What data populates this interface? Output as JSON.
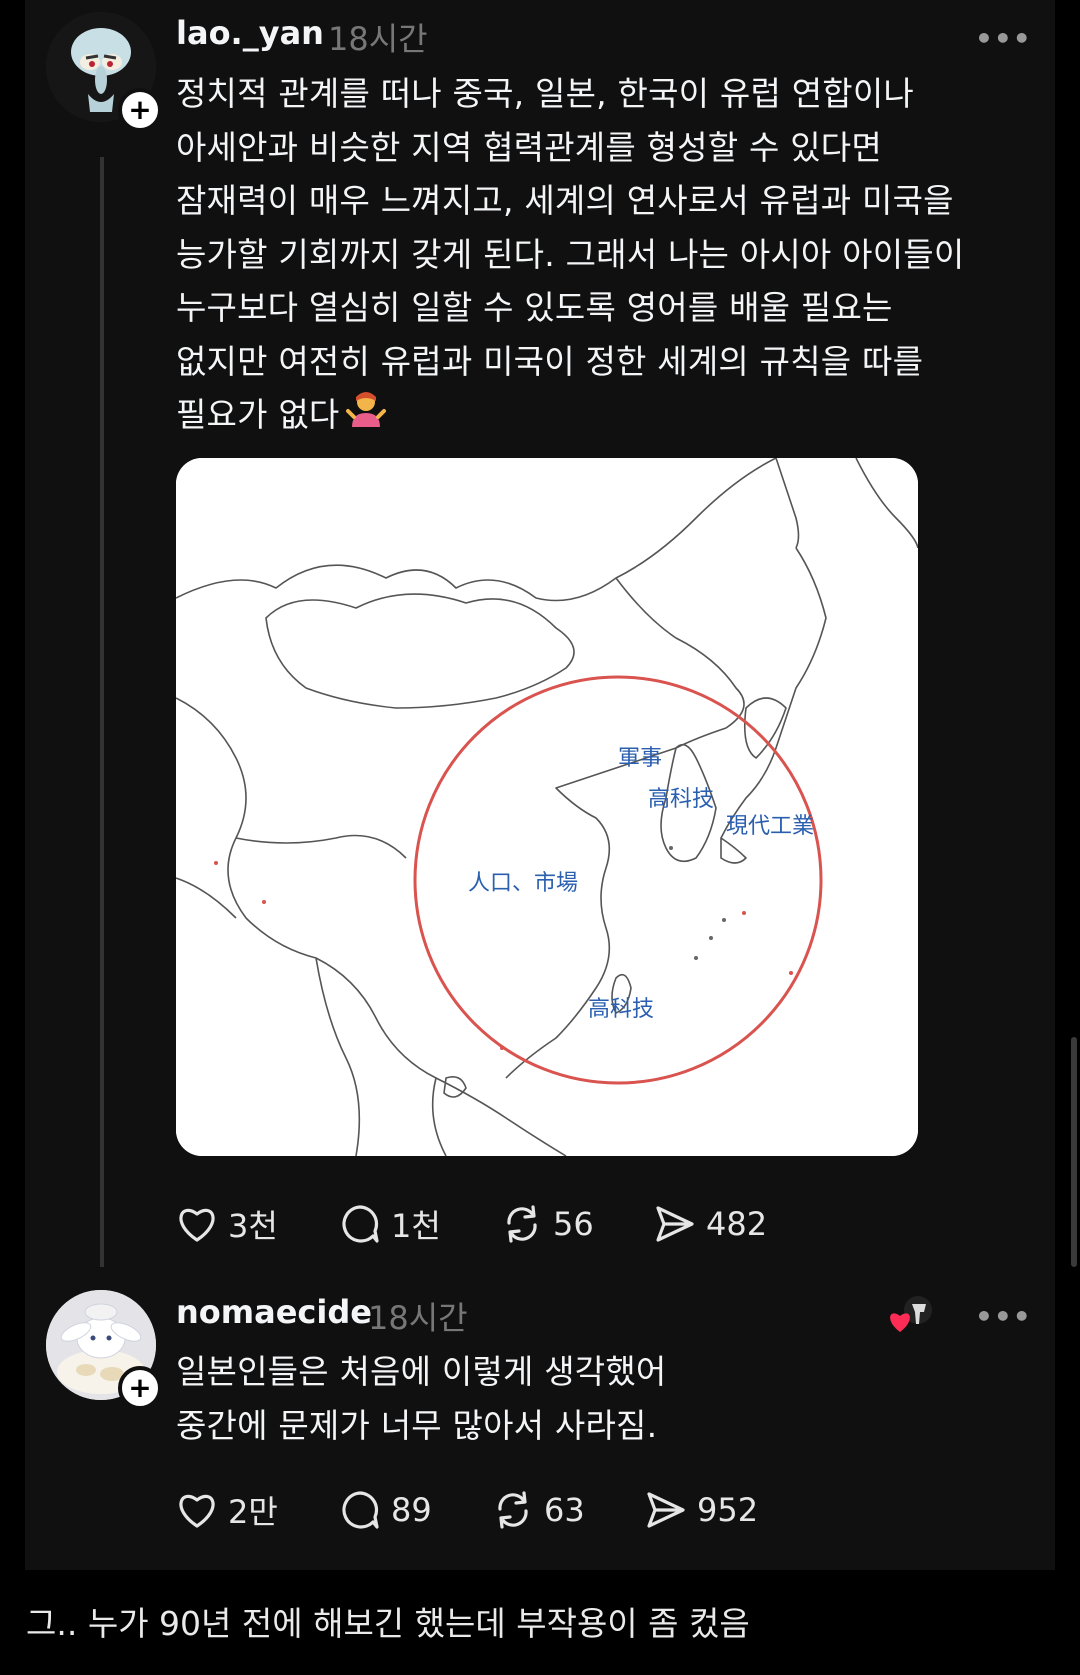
{
  "post": {
    "username": "lao._yan",
    "time": "18시간",
    "text": "정치적 관계를 떠나 중국, 일본, 한국이 유럽 연합이나\n아세안과 비슷한 지역 협력관계를 형성할 수 있다면\n잠재력이 매우 느껴지고, 세계의 연사로서 유럽과 미국을\n능가할 기회까지 갖게 된다. 그래서 나는 아시아 아이들이\n누구보다 열심히 일할 수 있도록 영어를 배울 필요는\n없지만 여전히 유럽과 미국이 정한 세계의 규칙을 따를\n필요가 없다",
    "map": {
      "labels": {
        "military": "軍事",
        "hightech_korea": "高科技",
        "modern_industry": "現代工業",
        "population_market": "人口、市場",
        "hightech_taiwan": "高科技"
      }
    },
    "stats": {
      "likes": "3천",
      "replies": "1천",
      "reposts": "56",
      "shares": "482"
    }
  },
  "reply": {
    "username": "nomaecide",
    "time": "18시간",
    "text": "일본인들은 처음에 이렇게 생각했어\n중간에 문제가 너무 많아서 사라짐.",
    "stats": {
      "likes": "2만",
      "replies": "89",
      "reposts": "63",
      "shares": "952"
    }
  },
  "caption": "그.. 누가 90년 전에 해보긴 했는데 부작용이 좀 컸음",
  "icons": {
    "like": "heart-outline-icon",
    "reply": "speech-bubble-icon",
    "repost": "repost-arrows-icon",
    "share": "paper-plane-icon",
    "more": "more-dots-icon",
    "follow": "plus-icon",
    "emoji": "person-shrugging-emoji"
  },
  "colors": {
    "background": "#101010",
    "text": "#f3f5f7",
    "muted": "#777777",
    "map_circle": "#d9534f",
    "map_label": "#2a5fb0",
    "heart_badge": "#ff2d55"
  }
}
